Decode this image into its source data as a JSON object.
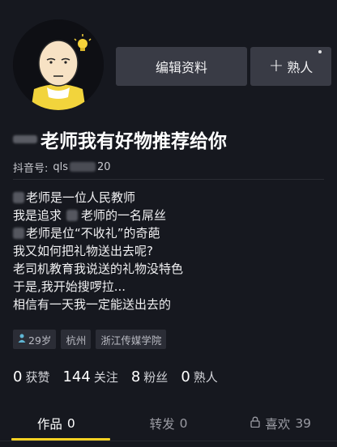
{
  "profile": {
    "title_text": "老师我有好物推荐给你",
    "douyin_label": "抖音号:",
    "douyin_id_prefix": "qls",
    "douyin_id_suffix": "20"
  },
  "actions": {
    "edit_label": "编辑资料",
    "friend_label": "熟人"
  },
  "bio": {
    "line1": "老师是一位人民教师",
    "line2_a": "我是追求",
    "line2_b": "老师的一名屌丝",
    "line3": "老师是位“不收礼”的奇葩",
    "line4": "我又如何把礼物送出去呢?",
    "line5": "老司机教育我说送的礼物没特色",
    "line6": "于是,我开始搜啰拉...",
    "line7": "相信有一天我一定能送出去的"
  },
  "tags": {
    "age": "29岁",
    "city": "杭州",
    "school": "浙江传媒学院"
  },
  "stats": {
    "likes_num": "0",
    "likes_label": "获赞",
    "following_num": "144",
    "following_label": "关注",
    "fans_num": "8",
    "fans_label": "粉丝",
    "acq_num": "0",
    "acq_label": "熟人"
  },
  "tabs": {
    "works_label": "作品",
    "works_count": "0",
    "repost_label": "转发",
    "repost_count": "0",
    "likes_label": "喜欢",
    "likes_count": "39"
  },
  "colors": {
    "background": "#16181f",
    "button": "#393b45",
    "tab_indicator": "#f5d023",
    "tag_bg": "#2b2d36"
  },
  "icons": [
    "avatar-saitama-illustration",
    "plus-icon",
    "person-icon",
    "lock-icon"
  ]
}
